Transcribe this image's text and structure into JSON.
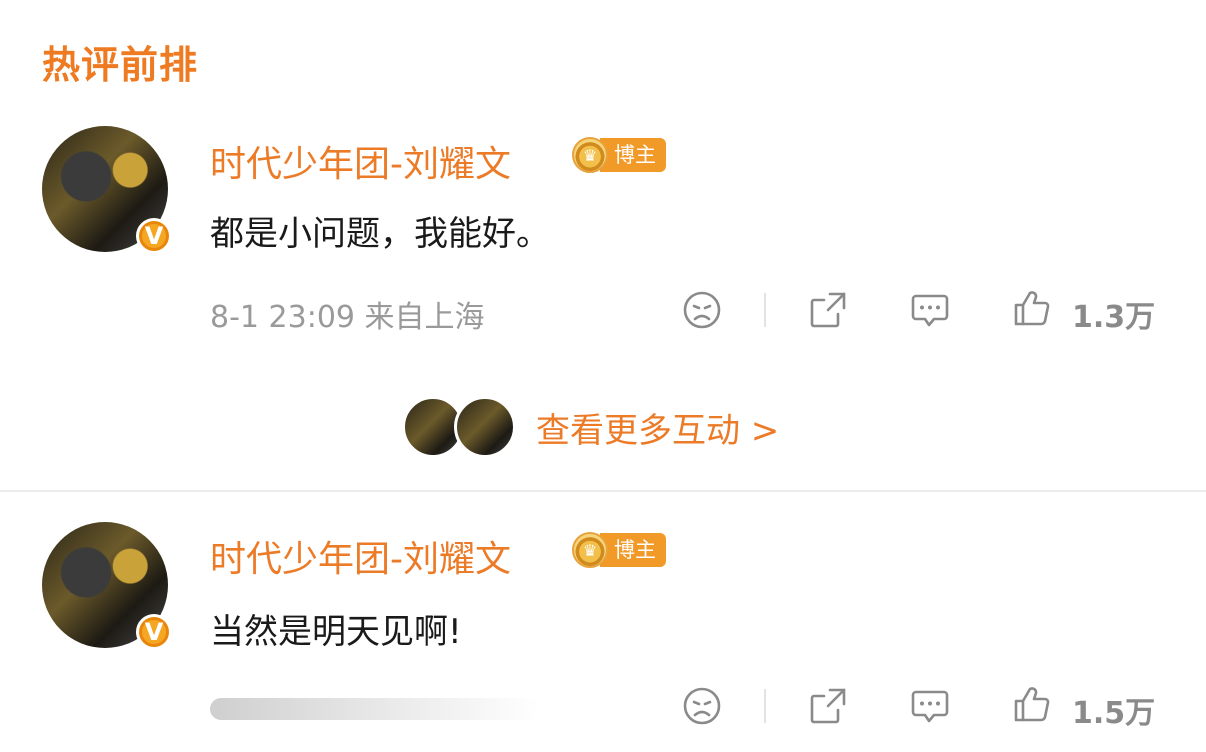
{
  "section_title": "热评前排",
  "comments": [
    {
      "username": "时代少年团-刘耀文",
      "badge_label": "博主",
      "verified_mark": "V",
      "text": "都是小问题，我能好。",
      "meta": "8-1 23:09 来自上海",
      "likes": "1.3万"
    },
    {
      "username": "时代少年团-刘耀文",
      "badge_label": "博主",
      "verified_mark": "V",
      "text": "当然是明天见啊!",
      "meta": "",
      "likes": "1.5万"
    }
  ],
  "more_interactions": "查看更多互动 >",
  "icons": [
    "dislike-face-icon",
    "share-icon",
    "comment-icon",
    "like-icon"
  ],
  "colors": {
    "accent": "#ec7b28",
    "badge": "#f29a28",
    "verified": "#f5a623",
    "muted": "#9a9a9a"
  }
}
